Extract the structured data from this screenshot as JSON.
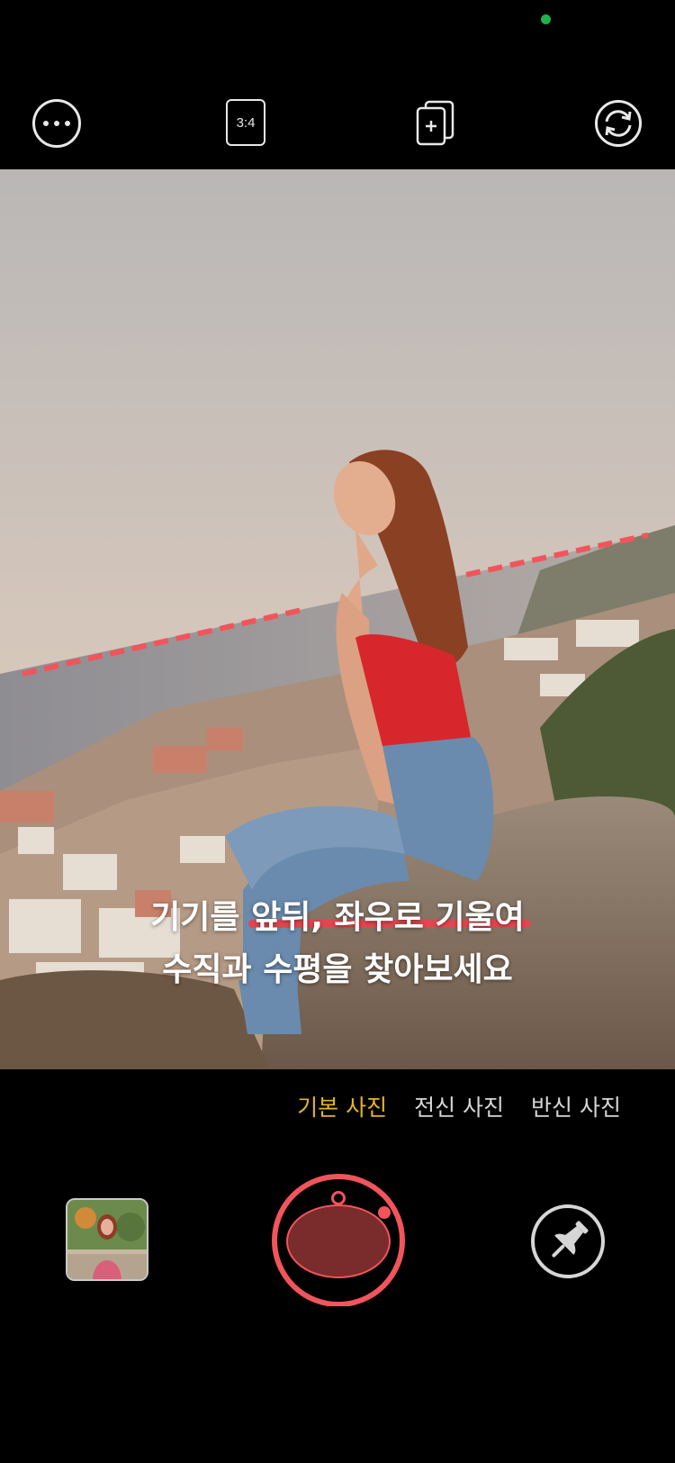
{
  "toolbar": {
    "ratio_label": "3:4",
    "icons": [
      "more-icon",
      "ratio-icon",
      "add-layer-icon",
      "switch-camera-icon"
    ]
  },
  "hint": {
    "line1": "기기를 앞뒤, 좌우로 기울여",
    "line2": "수직과 수평을 찾아보세요"
  },
  "modes": [
    {
      "label": "기본 사진",
      "active": true
    },
    {
      "label": "전신 사진",
      "active": false
    },
    {
      "label": "반신 사진",
      "active": false
    }
  ],
  "colors": {
    "accent": "#e5b523",
    "guide_line": "#e0474f",
    "shutter_ring": "#f2545b",
    "shutter_fill": "#7a2b2b",
    "status_dot": "#1fb24a"
  }
}
